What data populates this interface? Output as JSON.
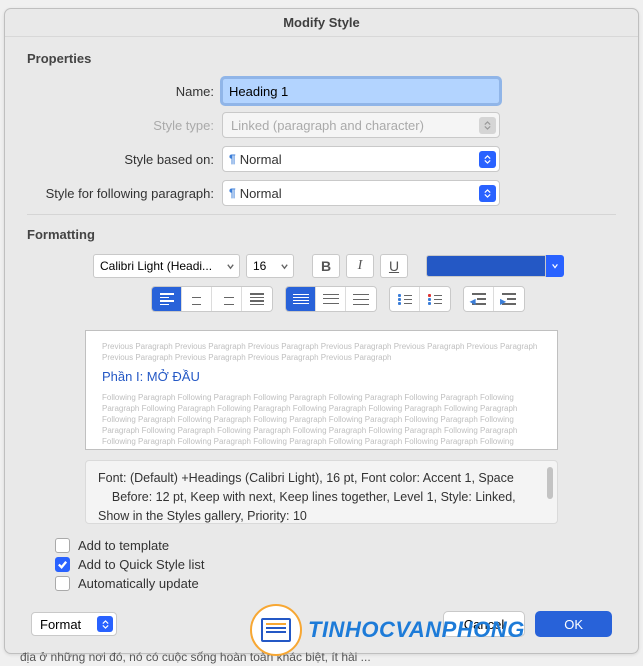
{
  "dialog": {
    "title": "Modify Style",
    "properties": {
      "header": "Properties",
      "name_label": "Name:",
      "name_value": "Heading 1",
      "type_label": "Style type:",
      "type_value": "Linked (paragraph and character)",
      "based_label": "Style based on:",
      "based_value": "Normal",
      "following_label": "Style for following paragraph:",
      "following_value": "Normal"
    },
    "formatting": {
      "header": "Formatting",
      "font": "Calibri Light (Headi...",
      "size": "16",
      "bold": "B",
      "italic": "I",
      "underline": "U"
    },
    "preview": {
      "prev": "Previous Paragraph Previous Paragraph Previous Paragraph Previous Paragraph Previous Paragraph Previous Paragraph Previous Paragraph Previous Paragraph Previous Paragraph Previous Paragraph",
      "sample": "Phần I: MỞ ĐẦU",
      "follow": "Following Paragraph Following Paragraph Following Paragraph Following Paragraph Following Paragraph Following Paragraph Following Paragraph Following Paragraph Following Paragraph Following Paragraph Following Paragraph Following Paragraph Following Paragraph Following Paragraph Following Paragraph Following Paragraph Following Paragraph Following Paragraph Following Paragraph Following Paragraph Following Paragraph Following Paragraph Following Paragraph Following Paragraph Following Paragraph Following Paragraph Following Paragraph Following Paragraph Following Paragraph Following Paragraph"
    },
    "description": {
      "line1": "Font: (Default) +Headings (Calibri Light), 16 pt, Font color: Accent 1, Space",
      "line2": "    Before:  12 pt, Keep with next, Keep lines together, Level 1, Style: Linked, Show in the Styles gallery, Priority: 10"
    },
    "checkboxes": {
      "template": "Add to template",
      "quick": "Add to Quick Style list",
      "auto": "Automatically update"
    },
    "footer": {
      "format": "Format",
      "cancel": "Cancel",
      "ok": "OK"
    }
  },
  "logo": "TINHOCVANPHONG",
  "bg_text": "địa ở những nơi đó, nó có cuộc sống hoàn toàn khác biệt, ít hài ..."
}
